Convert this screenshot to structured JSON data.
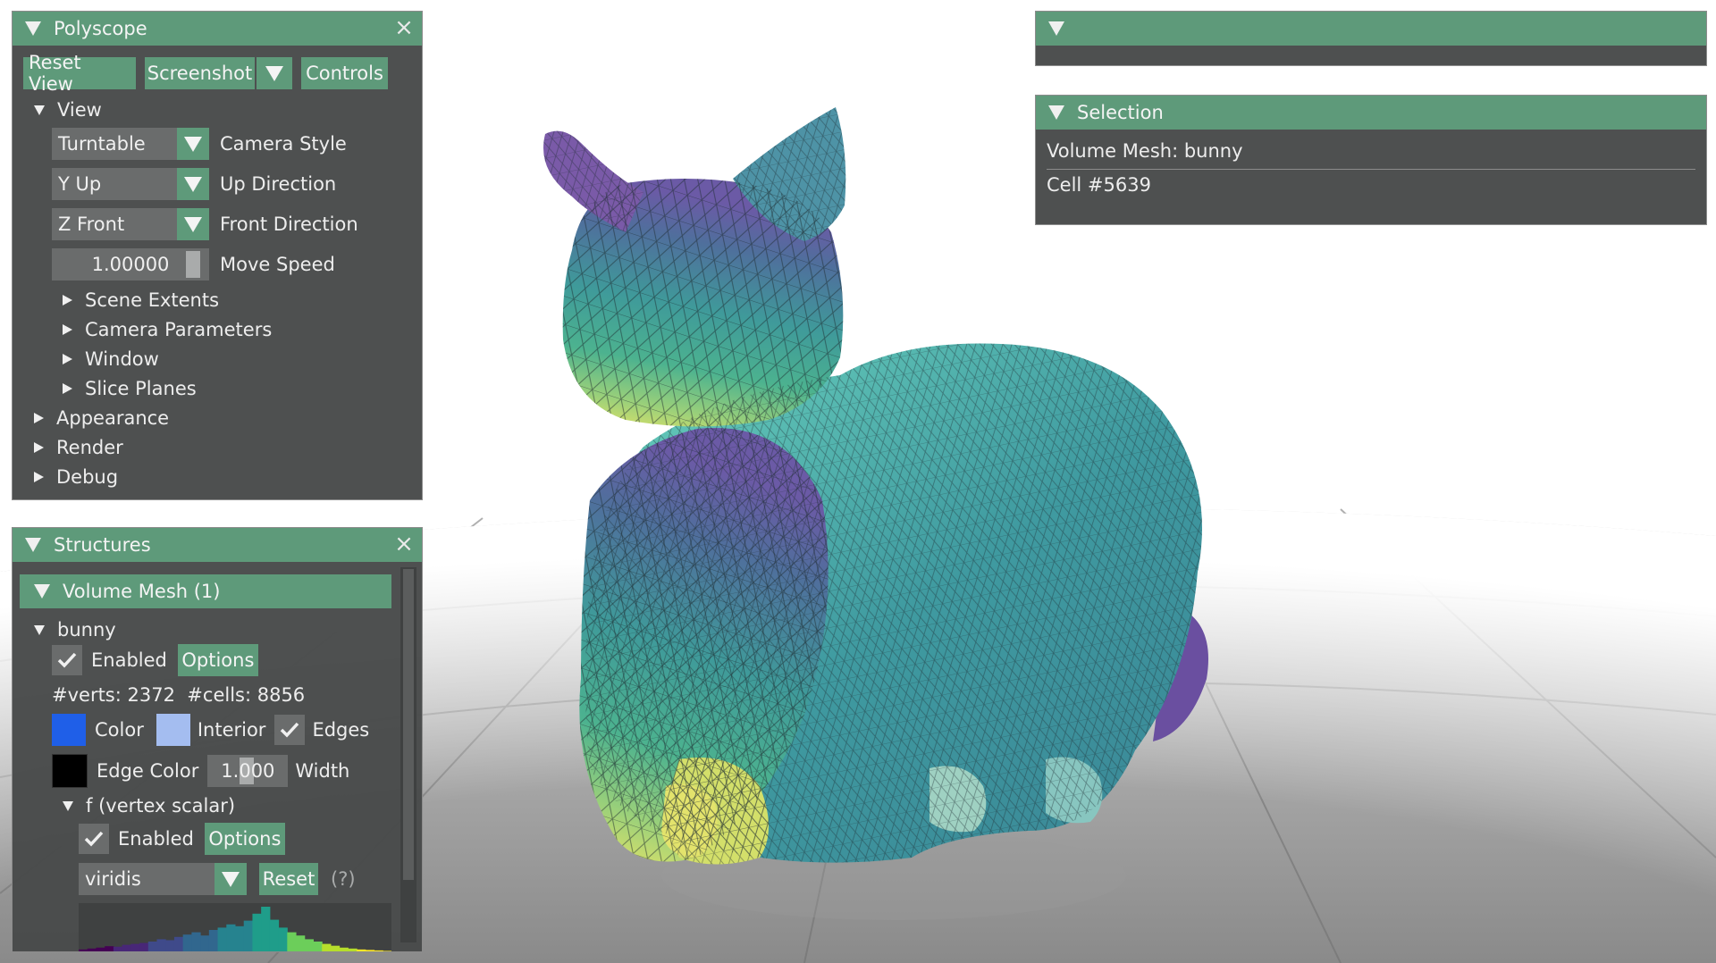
{
  "colors": {
    "title_bar": "#5e9a7a",
    "panel_bg": "#484a4a",
    "color_swatch": "#1f5fe8",
    "interior_swatch": "#a4bdf0",
    "edge_color_swatch": "#000000"
  },
  "polyscope": {
    "title": "Polyscope",
    "reset_view": "Reset View",
    "screenshot": "Screenshot",
    "controls": "Controls",
    "view_header": "View",
    "camera_style": {
      "value": "Turntable",
      "label": "Camera Style"
    },
    "up_direction": {
      "value": "Y Up",
      "label": "Up Direction"
    },
    "front_direction": {
      "value": "Z Front",
      "label": "Front Direction"
    },
    "move_speed": {
      "value": "1.00000",
      "label": "Move Speed"
    },
    "view_children": [
      "Scene Extents",
      "Camera Parameters",
      "Window",
      "Slice Planes"
    ],
    "sections": [
      "Appearance",
      "Render",
      "Debug"
    ]
  },
  "structures": {
    "title": "Structures",
    "group_header": "Volume Mesh (1)",
    "mesh_name": "bunny",
    "enabled_label": "Enabled",
    "options_label": "Options",
    "stats": "#verts: 2372  #cells: 8856",
    "color_label": "Color",
    "interior_label": "Interior",
    "edges_label": "Edges",
    "edge_color_label": "Edge Color",
    "width_value": "1.000",
    "width_label": "Width",
    "quantity_name": "f (vertex scalar)",
    "q_enabled_label": "Enabled",
    "q_options_label": "Options",
    "colormap": "viridis",
    "reset_label": "Reset",
    "help": "(?)",
    "histogram": [
      0.08,
      0.1,
      0.12,
      0.15,
      0.14,
      0.18,
      0.2,
      0.22,
      0.25,
      0.3,
      0.28,
      0.35,
      0.4,
      0.45,
      0.38,
      0.5,
      0.55,
      0.62,
      0.58,
      0.7,
      0.85,
      1.0,
      0.72,
      0.55,
      0.45,
      0.38,
      0.3,
      0.25,
      0.2,
      0.16,
      0.12,
      0.1,
      0.08,
      0.07,
      0.06,
      0.05
    ]
  },
  "selection": {
    "title": "Selection",
    "line1": "Volume Mesh: bunny",
    "line2": "Cell #5639"
  }
}
